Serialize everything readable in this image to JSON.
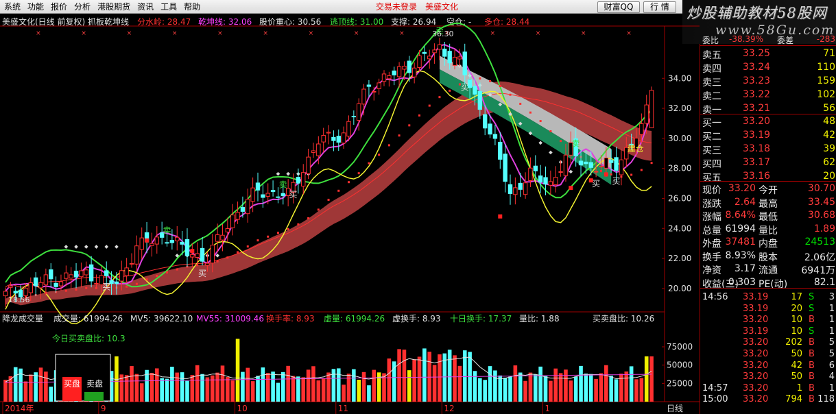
{
  "menubar": {
    "items": [
      "系统",
      "功能",
      "报价",
      "分析",
      "港股期货",
      "资讯",
      "工具",
      "帮助"
    ],
    "status_left": "交易未登录",
    "stock_name": "美盛文化",
    "btn_wealth": "财富QQ",
    "btn_quote": "行 情"
  },
  "watermark": {
    "title": "炒股辅助教材58股网",
    "url": "www.58Gu.com"
  },
  "price_header": {
    "title": "美盛文化(日线 前复权) 抓板乾坤线",
    "fenshui": "分水岭: 28.47",
    "qiankun": "乾坤线: 32.06",
    "gujia": "股价重心: 30.56",
    "taoding": "逃顶线: 31.00",
    "zhicheng": "支撑: 26.94",
    "kongcang": "空仓: -",
    "duocang": "多仓: 28.44"
  },
  "price_axis": [
    "34.00",
    "32.00",
    "30.00",
    "28.00",
    "26.00",
    "24.00",
    "22.00",
    "20.00"
  ],
  "annotations": {
    "high_label": "36.30",
    "low_label": "18.56",
    "sell": "卖",
    "buy": "买",
    "jiancang": "建仓"
  },
  "volume_header": {
    "title": "降龙成交量",
    "cjl": "成交量: 61994.26",
    "mv5": "MV5: 39622.10",
    "mv55": "MV55: 31009.46",
    "hsl": "换手率: 8.93",
    "xuliang": "虚量: 61994.26",
    "xuhuanshou": "虚换手: 8.93",
    "shiri": "十日换手: 17.37",
    "liangbi": "量比: 1.88",
    "maimaibi": "买卖盘比: 10.26"
  },
  "volume_panel": {
    "today_ratio": "今日买卖盘比: 10.3",
    "buy_label": "买盘",
    "sell_label": "卖盘"
  },
  "volume_axis": [
    "75000",
    "50000",
    "25000"
  ],
  "time_axis": {
    "labels": [
      "2014年",
      "9",
      "10",
      "11",
      "12",
      "1"
    ],
    "period": "日线"
  },
  "order_book": {
    "sells": [
      {
        "label": "卖五",
        "price": "33.25",
        "vol": "71"
      },
      {
        "label": "卖四",
        "price": "33.24",
        "vol": "110"
      },
      {
        "label": "卖三",
        "price": "33.23",
        "vol": "159"
      },
      {
        "label": "卖二",
        "price": "33.22",
        "vol": "102"
      },
      {
        "label": "卖一",
        "price": "33.21",
        "vol": "56"
      }
    ],
    "buys": [
      {
        "label": "买一",
        "price": "33.20",
        "vol": "48"
      },
      {
        "label": "买二",
        "price": "33.19",
        "vol": "42"
      },
      {
        "label": "买三",
        "price": "33.18",
        "vol": "39"
      },
      {
        "label": "买四",
        "price": "33.17",
        "vol": "62"
      },
      {
        "label": "买五",
        "price": "33.16",
        "vol": "20"
      }
    ]
  },
  "stats": [
    {
      "l1": "现价",
      "v1": "33.20",
      "l2": "今开",
      "v2": "30.70"
    },
    {
      "l1": "涨跌",
      "v1": "2.64",
      "l2": "最高",
      "v2": "33.45"
    },
    {
      "l1": "涨幅",
      "v1": "8.64%",
      "l2": "最低",
      "v2": "30.68"
    },
    {
      "l1": "总量",
      "v1": "61994",
      "l2": "量比",
      "v2": "1.89"
    },
    {
      "l1": "外盘",
      "v1": "37481",
      "l2": "内盘",
      "v2": "24513"
    },
    {
      "l1": "换手",
      "v1": "8.93%",
      "l2": "股本",
      "v2": "2.06亿"
    },
    {
      "l1": "净资",
      "v1": "3.17",
      "l2": "流通",
      "v2": "6941万"
    },
    {
      "l1": "收益(三)",
      "v1": "0.303",
      "l2": "PE(动)",
      "v2": "82.1"
    }
  ],
  "ticks": [
    {
      "time": "14:56",
      "price": "33.19",
      "vol": "17",
      "dir": "S",
      "n": "3"
    },
    {
      "time": "",
      "price": "33.19",
      "vol": "20",
      "dir": "S",
      "n": "1"
    },
    {
      "time": "",
      "price": "33.20",
      "vol": "10",
      "dir": "B",
      "n": "1"
    },
    {
      "time": "",
      "price": "33.19",
      "vol": "10",
      "dir": "S",
      "n": "1"
    },
    {
      "time": "",
      "price": "33.20",
      "vol": "202",
      "dir": "B",
      "n": "5"
    },
    {
      "time": "",
      "price": "33.20",
      "vol": "50",
      "dir": "B",
      "n": "5"
    },
    {
      "time": "",
      "price": "33.20",
      "vol": "42",
      "dir": "B",
      "n": "6"
    },
    {
      "time": "",
      "price": "33.20",
      "vol": "50",
      "dir": "B",
      "n": "4"
    },
    {
      "time": "14:57",
      "price": "33.20",
      "vol": "1",
      "dir": "B",
      "n": "1"
    },
    {
      "time": "15:00",
      "price": "33.20",
      "vol": "794",
      "dir": "B",
      "n": "118"
    }
  ],
  "order_book_header": {
    "ratio_label": "委比",
    "ratio": "-38.39%",
    "diff_label": "委差",
    "diff": "-283"
  },
  "colors": {
    "up": "#ff3030",
    "down": "#54ffff",
    "ma_green": "#3ee03e",
    "ma_magenta": "#e040e0",
    "ma_yellow": "#f0f030",
    "band_red": "#a83a3a",
    "band_grey": "#b8b8b8",
    "band_green": "#1a8a5a"
  }
}
